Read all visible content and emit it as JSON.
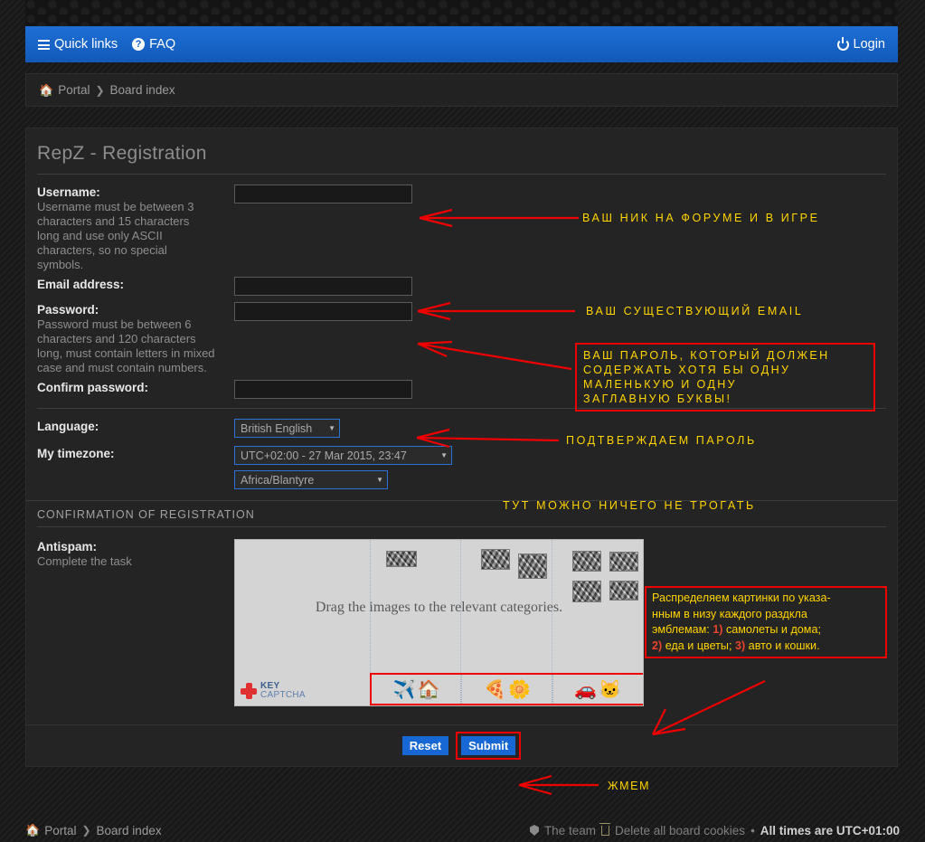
{
  "navbar": {
    "quick_links": "Quick links",
    "faq": "FAQ",
    "login": "Login"
  },
  "breadcrumb": {
    "portal": "Portal",
    "separator": "❯",
    "board_index": "Board index"
  },
  "panel": {
    "title": "RepZ - Registration",
    "confirmation_heading": "CONFIRMATION OF REGISTRATION"
  },
  "fields": {
    "username": {
      "label": "Username:",
      "description": "Username must be between 3 characters and 15 characters long and use only ASCII characters, so no special symbols.",
      "value": ""
    },
    "email": {
      "label": "Email address:",
      "value": ""
    },
    "password": {
      "label": "Password:",
      "description": "Password must be between 6 characters and 120 characters long, must contain letters in mixed case and must contain numbers.",
      "value": ""
    },
    "confirm_password": {
      "label": "Confirm password:",
      "value": ""
    },
    "language": {
      "label": "Language:",
      "selected": "British English"
    },
    "timezone": {
      "label": "My timezone:",
      "selected": "UTC+02:00 - 27 Mar 2015, 23:47",
      "region_selected": "Africa/Blantyre"
    },
    "antispam": {
      "label": "Antispam:",
      "description": "Complete the task"
    }
  },
  "captcha": {
    "message": "Drag the images to the relevant categories.",
    "logo_line1": "KEY",
    "logo_line2": "CAPTCHA",
    "categories": [
      {
        "icons": [
          "✈️",
          "🏠"
        ]
      },
      {
        "icons": [
          "🍕",
          "🌼"
        ]
      },
      {
        "icons": [
          "🚗",
          "🐱"
        ]
      }
    ]
  },
  "buttons": {
    "reset": "Reset",
    "submit": "Submit"
  },
  "footer": {
    "portal": "Portal",
    "board_index": "Board index",
    "the_team": "The team",
    "delete_cookies": "Delete all board cookies",
    "bullet": "•",
    "all_times": "All times are UTC+01:00"
  },
  "annotations": {
    "username": "ВАШ  НИК  НА  ФОРУМЕ  И  В  ИГРЕ",
    "email": "ВАШ  СУЩЕСТВУЮЩИЙ  EMAIL",
    "password_line1": "ВАШ  ПАРОЛЬ,  КОТОРЫЙ  ДОЛЖЕН",
    "password_line2": "СОДЕРЖАТЬ  ХОТЯ  БЫ  ОДНУ",
    "password_line3": "МАЛЕНЬКУЮ  И  ОДНУ",
    "password_line4": "ЗАГЛАВНУЮ  БУКВЫ!",
    "confirm": "ПОДТВЕРЖДАЕМ  ПАРОЛЬ",
    "timezone": "ТУТ  МОЖНО  НИЧЕГО  НЕ  ТРОГАТЬ",
    "captcha_l1a": "Распределяем картинки по указа-",
    "captcha_l2": "нным в низу каждого раздкла",
    "captcha_l3_pre": "эмблемам: ",
    "captcha_n1": "1)",
    "captcha_l3_post": " самолеты и дома;",
    "captcha_n2": "2)",
    "captcha_l4a": " еда и цветы; ",
    "captcha_n3": "3)",
    "captcha_l4b": " авто и кошки.",
    "submit": "ЖМЕМ"
  },
  "colors": {
    "accent_blue": "#1667cf",
    "annotation_yellow": "#ffd400",
    "annotation_red": "#ee0000",
    "panel_bg": "#242424"
  }
}
